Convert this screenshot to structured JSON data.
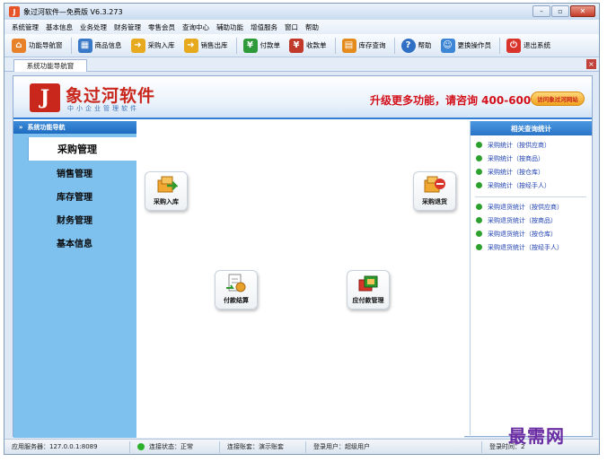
{
  "window": {
    "title": "象过河软件—免费版 V6.3.273"
  },
  "menu": [
    "系统管理",
    "基本信息",
    "业务处理",
    "财务管理",
    "零售会员",
    "查询中心",
    "辅助功能",
    "增值服务",
    "窗口",
    "帮助"
  ],
  "toolbar": [
    {
      "label": "功能导航窗",
      "icon": "home-icon",
      "color": "#e8822a"
    },
    {
      "label": "商品信息",
      "icon": "grid-icon",
      "color": "#3a78c8"
    },
    {
      "label": "采购入库",
      "icon": "folder-in-icon",
      "color": "#e7a91e"
    },
    {
      "label": "销售出库",
      "icon": "folder-out-icon",
      "color": "#e7a91e"
    },
    {
      "label": "付款单",
      "icon": "payment-icon",
      "color": "#2f9a3a"
    },
    {
      "label": "收款单",
      "icon": "receipt-icon",
      "color": "#c0392b"
    },
    {
      "label": "库存查询",
      "icon": "stock-icon",
      "color": "#e58b1c"
    },
    {
      "label": "帮助",
      "icon": "help-icon",
      "color": "#2f6fc4"
    },
    {
      "label": "更换操作员",
      "icon": "users-icon",
      "color": "#3d86d6"
    },
    {
      "label": "退出系统",
      "icon": "power-icon",
      "color": "#d9342b"
    }
  ],
  "tab": {
    "label": "系统功能导航窗"
  },
  "banner": {
    "brand_name": "象过河软件",
    "brand_sub": "中小企业管理软件",
    "promo": "升级更多功能，请咨询 400-600-1168",
    "visit_label": "访问象过河网站"
  },
  "sidebar": {
    "header": "系统功能导航",
    "items": [
      "采购管理",
      "销售管理",
      "库存管理",
      "财务管理",
      "基本信息"
    ]
  },
  "modules": [
    {
      "label": "采购入库",
      "icon": "purchase-in-icon"
    },
    {
      "label": "采购退货",
      "icon": "purchase-return-icon"
    },
    {
      "label": "付款结算",
      "icon": "payment-settle-icon"
    },
    {
      "label": "应付款管理",
      "icon": "payable-icon"
    }
  ],
  "right_panel": {
    "header": "相关查询统计",
    "group1": [
      "采购统计（按供应商）",
      "采购统计（按商品）",
      "采购统计（按仓库）",
      "采购统计（按经手人）"
    ],
    "group2": [
      "采购退货统计（按供应商）",
      "采购退货统计（按商品）",
      "采购退货统计（按仓库）",
      "采购退货统计（按经手人）"
    ]
  },
  "status": {
    "server": "应用服务器：127.0.0.1:8089",
    "connection": "连接状态：正常",
    "account": "连接账套：演示账套",
    "user": "登录用户：超级用户",
    "login_time": "登录时间：2"
  },
  "watermark": "最需网"
}
